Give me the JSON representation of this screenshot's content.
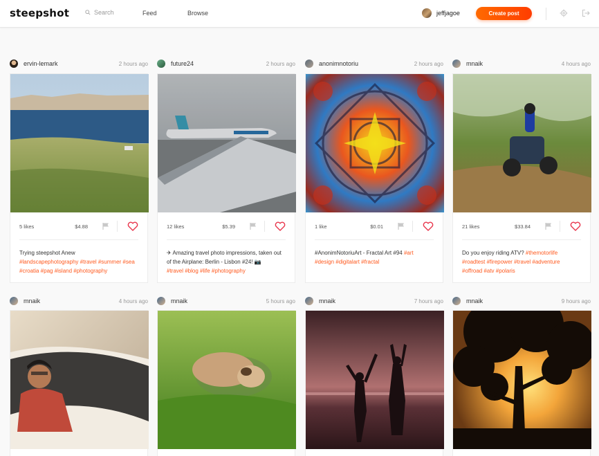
{
  "header": {
    "logo": "steepshot",
    "search_placeholder": "Search",
    "nav": [
      "Feed",
      "Browse"
    ],
    "username": "jeffjagoe",
    "create_label": "Create post"
  },
  "accent_color": "#ff5a1f",
  "posts": [
    {
      "author": "ervin-lemark",
      "time": "2 hours ago",
      "likes": "5 likes",
      "payout": "$4.88",
      "text": "Trying steepshot Anew",
      "tags": "#landscapephotography #travel #summer #sea #croatia #pag #island #photography"
    },
    {
      "author": "future24",
      "time": "2 hours ago",
      "likes": "12 likes",
      "payout": "$5.39",
      "text": "✈ Amazing travel photo impressions, taken out of the Airplane: Berlin - Lisbon #24! 📷",
      "tags": "#travel #blog #life #photography"
    },
    {
      "author": "anonimnotoriu",
      "time": "2 hours ago",
      "likes": "1 like",
      "payout": "$0.01",
      "text": "#AnonimNotoriuArt - Fractal Art #94",
      "tags": "#art #design #digitalart #fractal"
    },
    {
      "author": "mnaik",
      "time": "4 hours ago",
      "likes": "21 likes",
      "payout": "$33.84",
      "text": "Do you enjoy riding ATV?",
      "tags": "#themotorlife #roadtest #firepower #travel #adventure #offroad #atv #polaris"
    },
    {
      "author": "mnaik",
      "time": "4 hours ago"
    },
    {
      "author": "mnaik",
      "time": "5 hours ago"
    },
    {
      "author": "mnaik",
      "time": "7 hours ago"
    },
    {
      "author": "mnaik",
      "time": "9 hours ago"
    }
  ]
}
